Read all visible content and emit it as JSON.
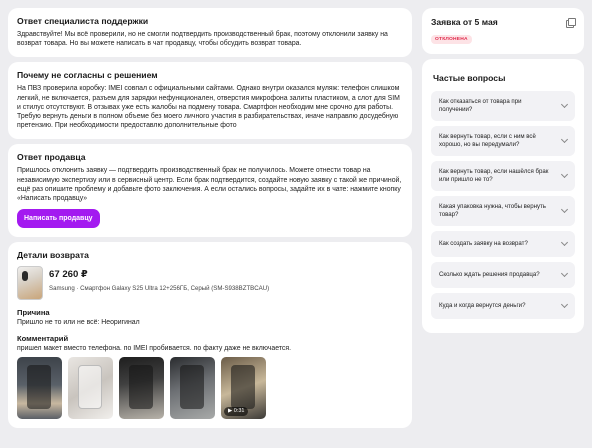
{
  "support": {
    "title": "Ответ специалиста поддержки",
    "text": "Здравствуйте! Мы всё проверили, но не смогли подтвердить производственный брак, поэтому отклонили заявку на возврат товара. Но вы можете написать в чат продавцу, чтобы обсудить возврат товара."
  },
  "disagree": {
    "title": "Почему не согласны с решением",
    "text": "На ПВЗ проверила коробку: IMEI совпал с официальными сайтами. Однако внутри оказался муляж: телефон слишком легкий, не включается, разъем для зарядки нефункционален, отверстия микрофона залиты пластиком, а слот для SIM и стилус отсутствуют. В отзывах уже есть жалобы на подмену товара. Смартфон необходим мне срочно для работы. Требую вернуть деньги в полном объеме без моего личного участия в разбирательствах, иначе направлю досудебную претензию. При необходимости предоставлю дополнительные фото"
  },
  "seller": {
    "title": "Ответ продавца",
    "text": "Пришлось отклонить заявку — подтвердить производственный брак не получилось. Можете отнести товар на независимую экспертизу или в сервисный центр. Если брак подтвердится, создайте новую заявку с такой же причиной, ещё раз опишите проблему и добавьте фото заключения. А если остались вопросы, задайте их в чате: нажмите кнопку «Написать продавцу»",
    "button_label": "Написать продавцу"
  },
  "details": {
    "title": "Детали возврата",
    "price": "67 260 ₽",
    "product_name": "Samsung · Смартфон Galaxy S25 Ultra 12+256ГБ, Серый (SM-S938BZTBCAU)",
    "reason_title": "Причина",
    "reason_text": "Пришло не то или не всё: Неоригинал",
    "comment_title": "Комментарий",
    "comment_text": "пришел макет вместо телефона. по IMEI пробивается. по факту даже не включается.",
    "video_duration": "0:31"
  },
  "request": {
    "title": "Заявка от 5 мая",
    "status": "ОТКЛОНЕНА",
    "status_color": "#e0284a"
  },
  "faq": {
    "title": "Частые вопросы",
    "items": [
      {
        "label": "Как отказаться от товара при получении?"
      },
      {
        "label": "Как вернуть товар, если с ним всё хорошо, но вы передумали?"
      },
      {
        "label": "Как вернуть товар, если нашёлся брак или пришло не то?"
      },
      {
        "label": "Какая упаковка нужна, чтобы вернуть товар?"
      },
      {
        "label": "Как создать заявку на возврат?"
      },
      {
        "label": "Сколько ждать решения продавца?"
      },
      {
        "label": "Куда и когда вернутся деньги?"
      }
    ]
  },
  "accent_color": "#a31af0"
}
